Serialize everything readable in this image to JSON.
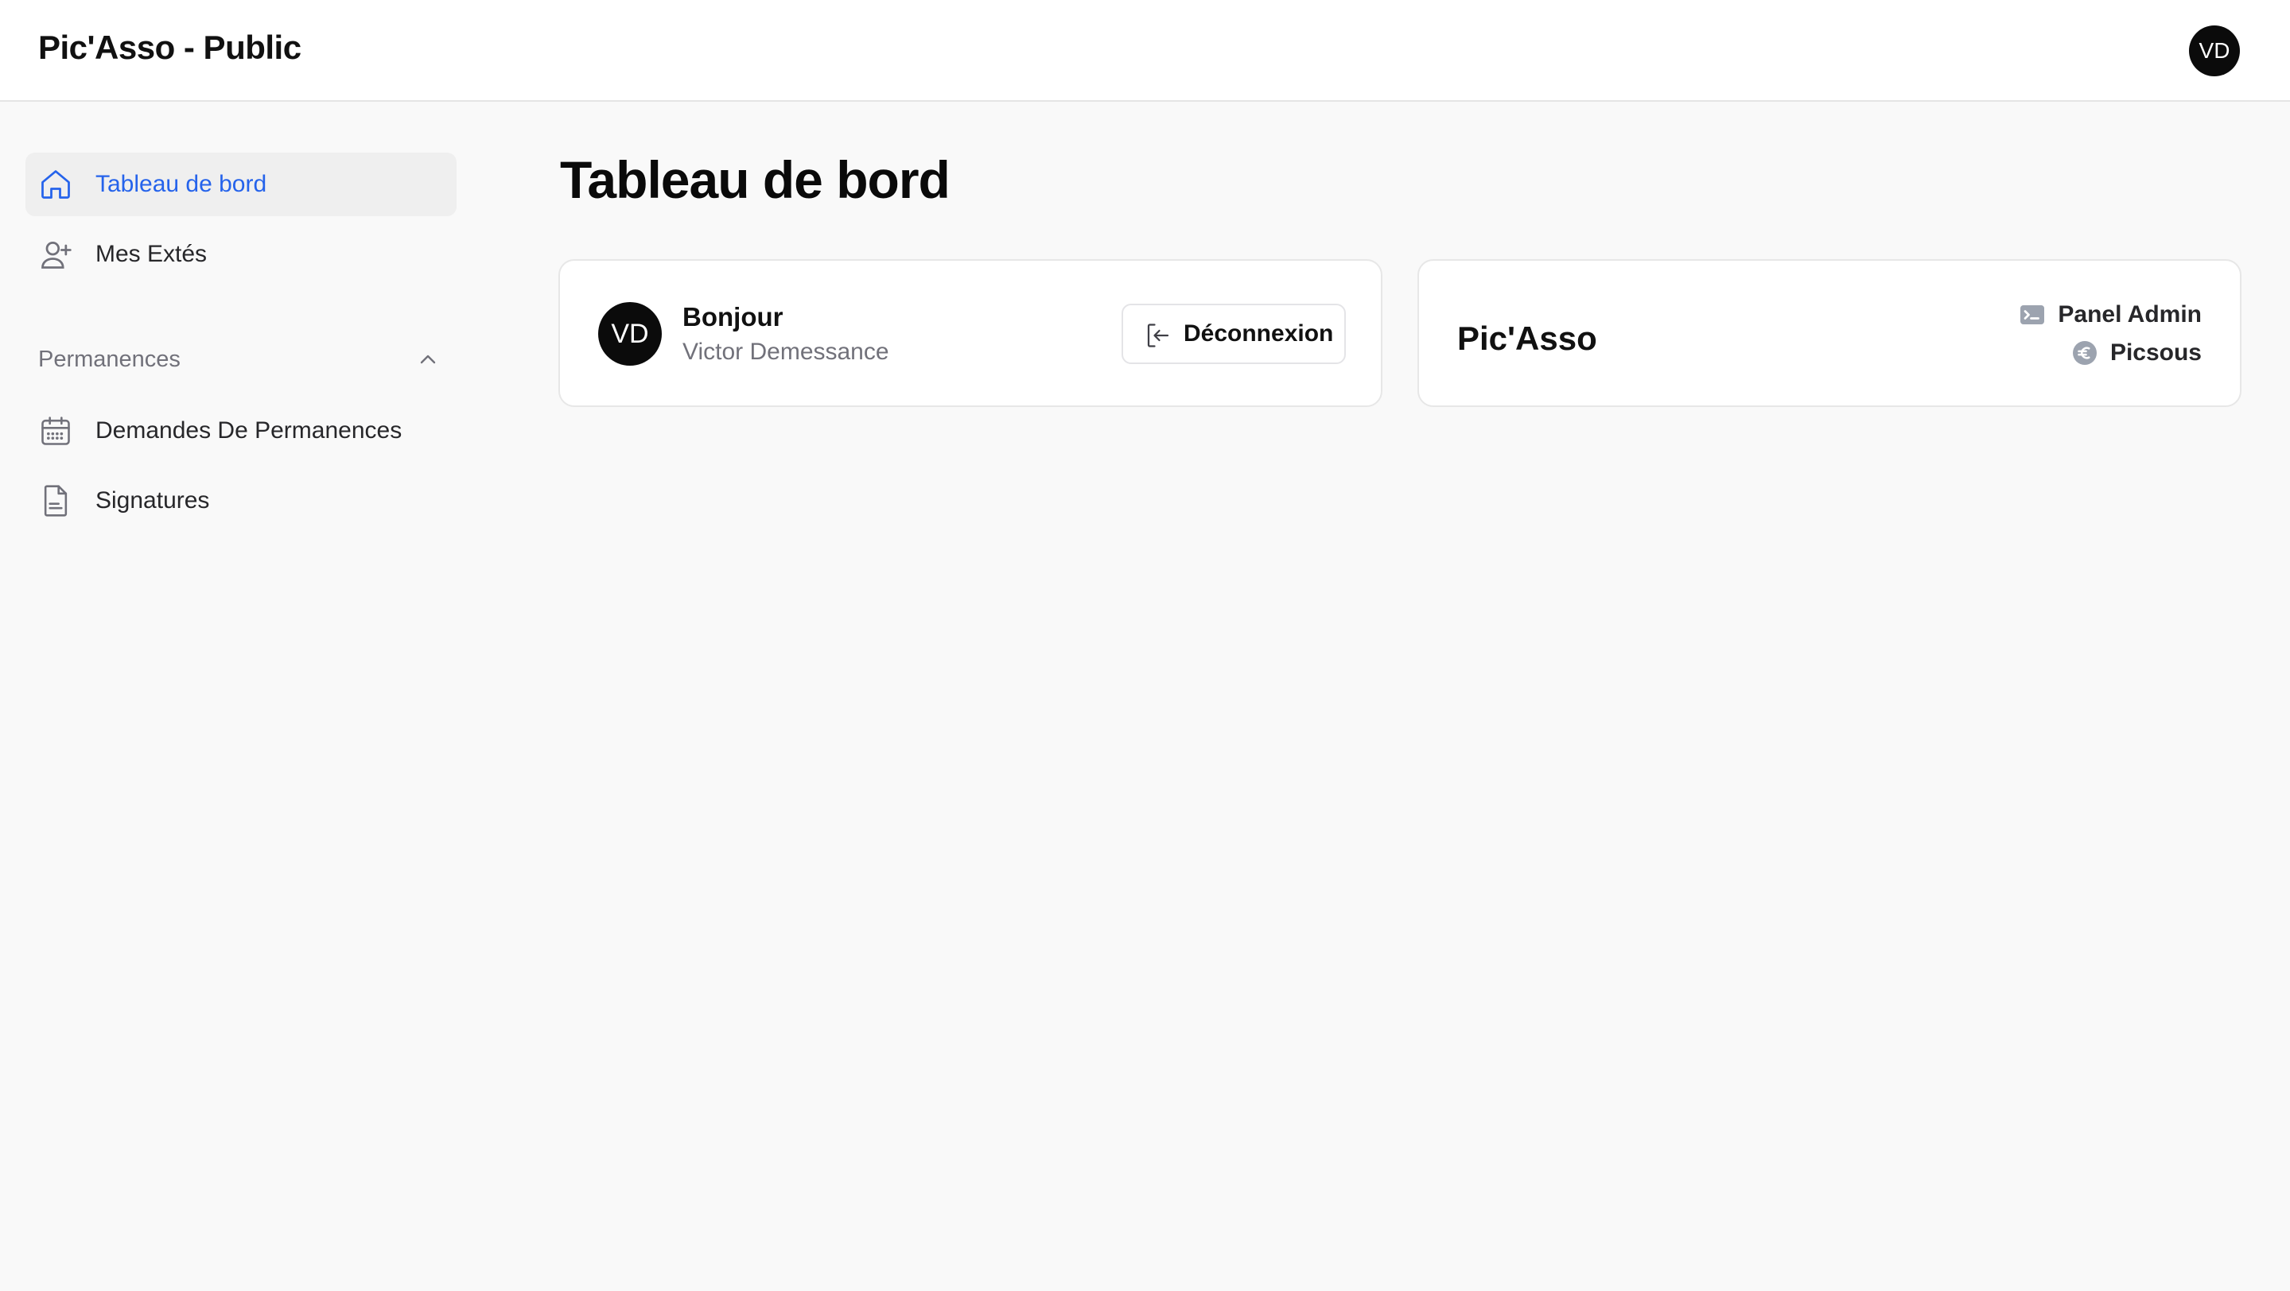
{
  "header": {
    "brand": "Pic'Asso - Public",
    "avatar_initials": "VD"
  },
  "sidebar": {
    "items": [
      {
        "label": "Tableau de bord",
        "icon": "home-icon",
        "active": true
      },
      {
        "label": "Mes Extés",
        "icon": "user-plus-icon",
        "active": false
      }
    ],
    "section": {
      "label": "Permanences",
      "expanded": true,
      "icon": "chevron-up-icon"
    },
    "section_items": [
      {
        "label": "Demandes De Permanences",
        "icon": "calendar-icon"
      },
      {
        "label": "Signatures",
        "icon": "document-icon"
      }
    ]
  },
  "main": {
    "title": "Tableau de bord",
    "user_card": {
      "avatar_initials": "VD",
      "greeting": "Bonjour",
      "name": "Victor Demessance",
      "logout_label": "Déconnexion",
      "logout_icon": "logout-icon"
    },
    "asso_card": {
      "name": "Pic'Asso",
      "links": [
        {
          "label": "Panel Admin",
          "icon": "terminal-icon"
        },
        {
          "label": "Picsous",
          "icon": "euro-icon"
        }
      ]
    }
  },
  "colors": {
    "accent": "#2563eb",
    "active_bg": "#efefef",
    "page_bg": "#f9f9f9",
    "avatar_bg": "#0b0b0b"
  }
}
